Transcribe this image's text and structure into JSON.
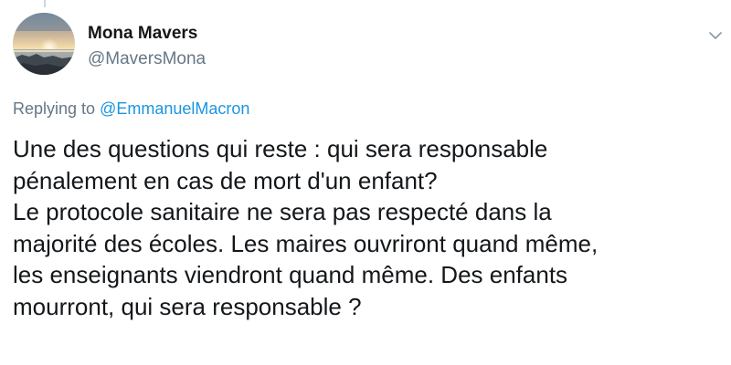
{
  "author": {
    "display_name": "Mona Mavers",
    "handle": "@MaversMona",
    "avatar": "sunset-over-sea"
  },
  "reply": {
    "prefix": "Replying to",
    "mention": "@EmmanuelMacron"
  },
  "tweet": {
    "lines": [
      "Une des questions qui reste : qui sera responsable",
      "pénalement en cas de mort d'un enfant?",
      "Le protocole sanitaire ne sera pas respecté dans la",
      "majorité des écoles. Les maires ouvriront quand même,",
      "les enseignants viendront quand même. Des enfants",
      "mourront, qui sera responsable ?"
    ]
  },
  "icons": {
    "menu": "chevron-down-icon"
  },
  "colors": {
    "text": "#14171a",
    "secondary": "#657786",
    "link": "#1b95e0",
    "thread_line": "#ccd6dd"
  }
}
